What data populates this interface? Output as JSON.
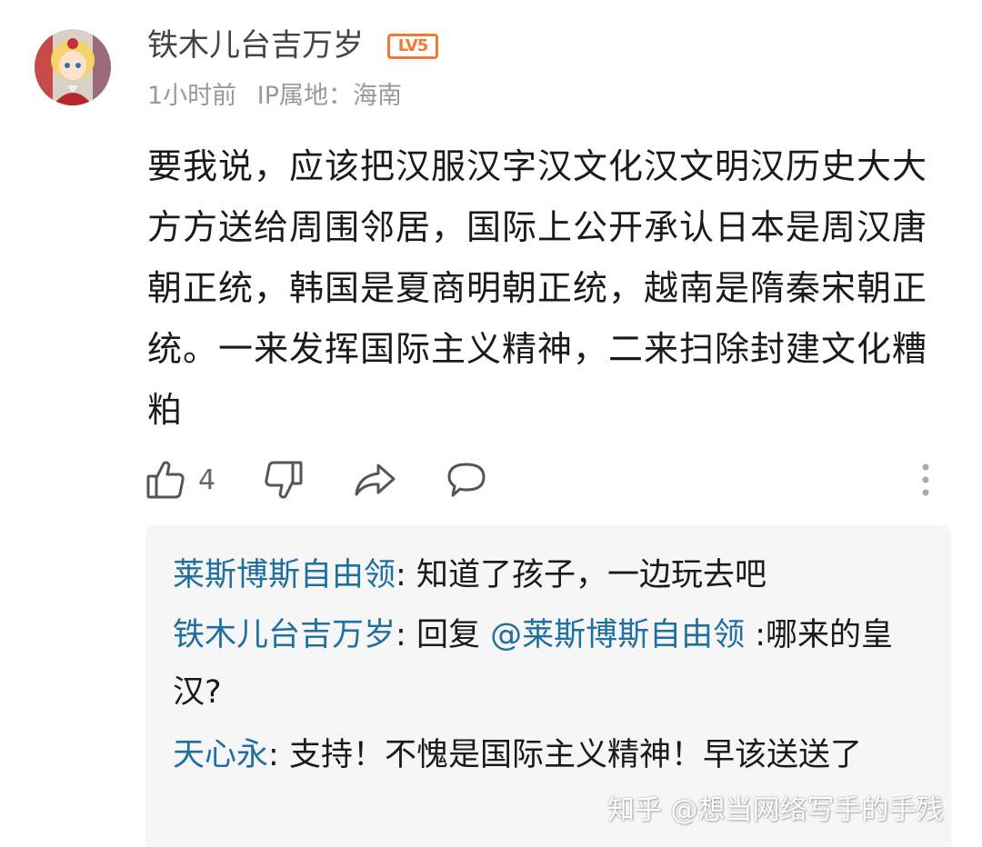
{
  "comment": {
    "username": "铁木儿台吉万岁",
    "level_badge": "LV5",
    "time": "1小时前",
    "ip_location": "IP属地：海南",
    "text": "要我说，应该把汉服汉字汉文化汉文明汉历史大大方方送给周围邻居，国际上公开承认日本是周汉唐朝正统，韩国是夏商明朝正统，越南是隋秦宋朝正统。一来发挥国际主义精神，二来扫除封建文化糟粕",
    "like_count": "4",
    "icons": {
      "like": "thumbs-up-icon",
      "dislike": "thumbs-down-icon",
      "share": "share-icon",
      "reply": "comment-bubble-icon",
      "more": "more-vertical-icon"
    },
    "colors": {
      "badge": "#f2792f",
      "reply_name": "#1f6f9f",
      "meta_text": "#999999"
    }
  },
  "replies": [
    {
      "name": "莱斯博斯自由领",
      "separator": ": ",
      "text": "知道了孩子，一边玩去吧"
    },
    {
      "name": "铁木儿台吉万岁",
      "separator": ": ",
      "prefix": "回复 ",
      "mention": "@莱斯博斯自由领",
      "text": " :哪来的皇汉?"
    },
    {
      "name": "天心永",
      "separator": ": ",
      "text": "支持！不愧是国际主义精神！早该送送了"
    }
  ],
  "watermark": "知乎 @想当网络写手的手残"
}
